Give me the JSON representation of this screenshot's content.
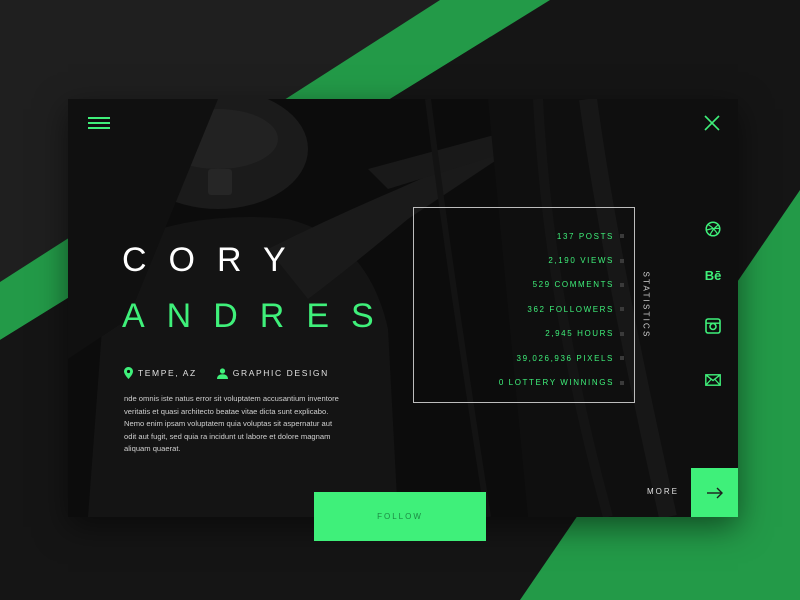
{
  "profile": {
    "first_name": "CORY",
    "last_name": "ANDRES",
    "location": "TEMPE, AZ",
    "profession": "GRAPHIC DESIGN",
    "bio": "nde omnis iste natus error sit voluptatem accusantium inventore veritatis et quasi architecto beatae vitae dicta sunt explicabo. Nemo enim ipsam voluptatem quia voluptas sit aspernatur aut odit aut fugit, sed quia ra incidunt ut labore et dolore magnam aliquam quaerat."
  },
  "statistics": {
    "label": "STATISTICS",
    "items": [
      "137 POSTS",
      "2,190 VIEWS",
      "529 COMMENTS",
      "362 FOLLOWERS",
      "2,945 HOURS",
      "39,026,936 PIXELS",
      "0 LOTTERY WINNINGS"
    ]
  },
  "social": {
    "behance_label": "Bē",
    "icons": [
      "dribbble-icon",
      "behance-icon",
      "instagram-icon",
      "mail-icon"
    ]
  },
  "actions": {
    "more_label": "MORE",
    "follow_label": "FOLLOW"
  },
  "colors": {
    "accent": "#3ff07a",
    "background_green": "#239a48",
    "card": "#0b0b0b"
  }
}
